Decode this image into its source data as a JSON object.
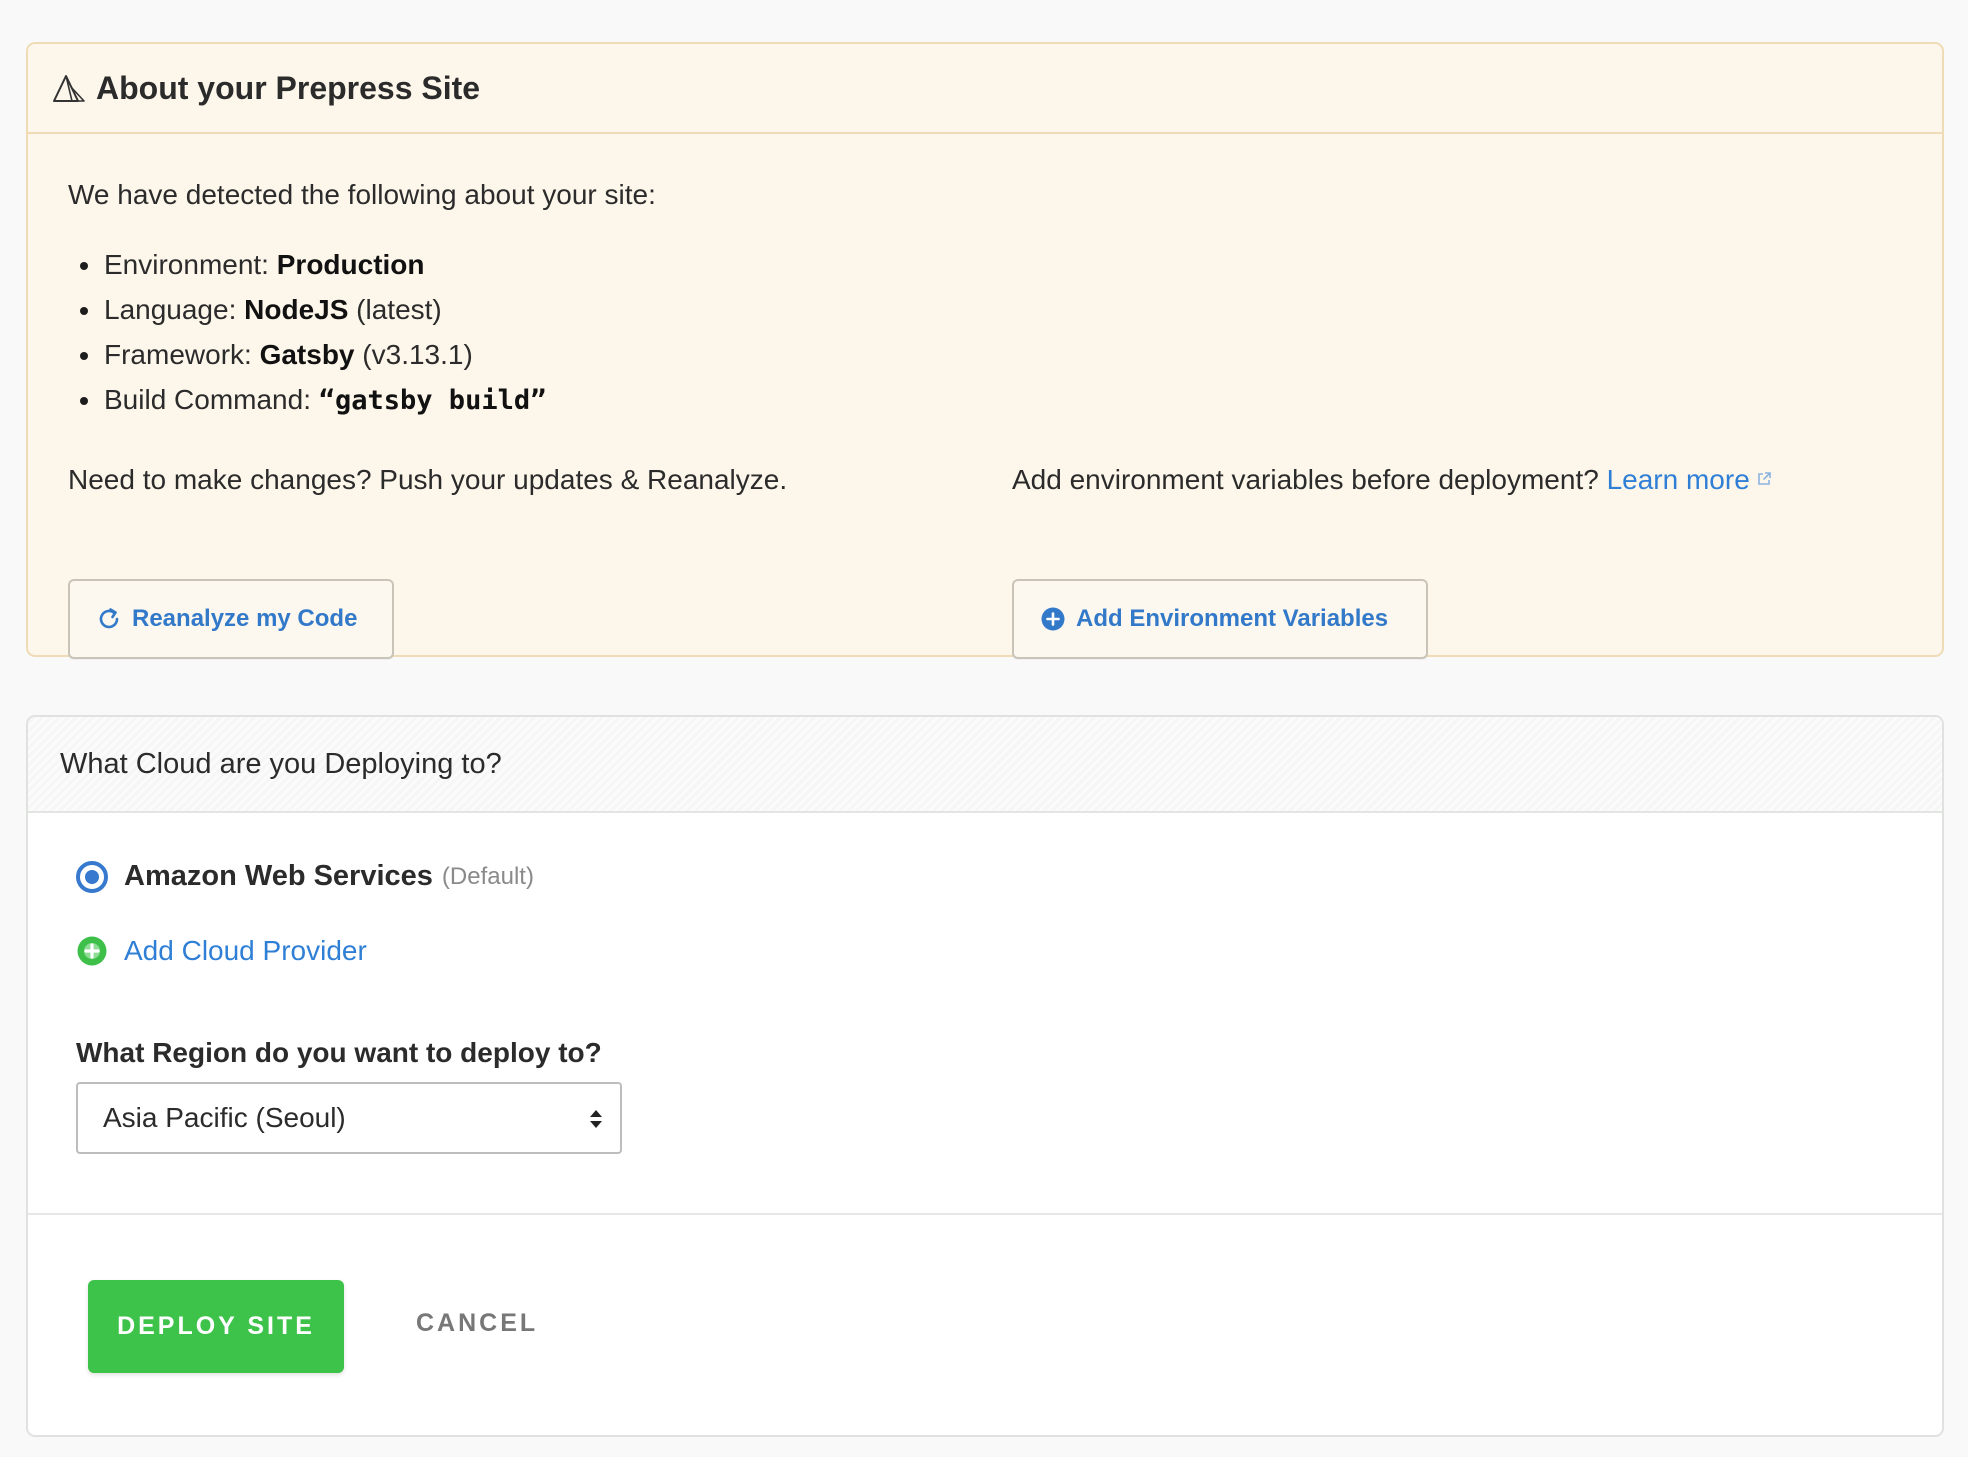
{
  "about": {
    "title": "About your Prepress Site",
    "intro": "We have detected the following about your site:",
    "facts": [
      {
        "label": "Environment: ",
        "value": "Production",
        "suffix": ""
      },
      {
        "label": "Language: ",
        "value": "NodeJS",
        "suffix": " (latest)"
      },
      {
        "label": "Framework: ",
        "value": "Gatsby",
        "suffix": " (v3.13.1)"
      },
      {
        "label": "Build Command: ",
        "value": "“gatsby build”",
        "suffix": ""
      }
    ],
    "changes_text": "Need to make changes? Push your updates & Reanalyze.",
    "reanalyze_label": "Reanalyze my Code",
    "env_text": "Add environment variables before deployment? ",
    "learn_more_label": "Learn more",
    "add_env_label": "Add Environment Variables"
  },
  "cloud": {
    "title": "What Cloud are you Deploying to?",
    "provider": {
      "name": "Amazon Web Services",
      "tag": "(Default)",
      "selected": true
    },
    "add_provider_label": "Add Cloud Provider",
    "region_label": "What Region do you want to deploy to?",
    "region_value": "Asia Pacific (Seoul)"
  },
  "actions": {
    "deploy_label": "DEPLOY SITE",
    "cancel_label": "CANCEL"
  },
  "icons": {
    "about_logo": "mountain-triangle-icon",
    "reanalyze": "refresh-icon",
    "add_env": "plus-circle-icon",
    "learn_more": "external-link-icon",
    "add_provider": "plus-circle-green-icon",
    "region_select": "select-arrows-icon"
  },
  "colors": {
    "accent_blue": "#2f7fd6",
    "deploy_green": "#3dc24a",
    "about_bg": "#fdf6ea",
    "about_border": "#efdcb6"
  }
}
